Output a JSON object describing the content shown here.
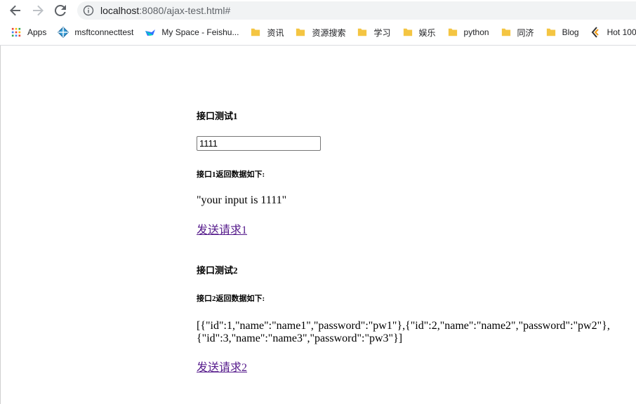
{
  "browser": {
    "url_host": "localhost",
    "url_path": ":8080/ajax-test.html#",
    "bookmarks": [
      {
        "label": "Apps",
        "icon": "apps-grid-icon"
      },
      {
        "label": "msftconnecttest",
        "icon": "globe-icon"
      },
      {
        "label": "My Space - Feishu...",
        "icon": "feishu-icon"
      },
      {
        "label": "资讯",
        "icon": "folder-icon"
      },
      {
        "label": "资源搜索",
        "icon": "folder-icon"
      },
      {
        "label": "学习",
        "icon": "folder-icon"
      },
      {
        "label": "娱乐",
        "icon": "folder-icon"
      },
      {
        "label": "python",
        "icon": "folder-icon"
      },
      {
        "label": "同济",
        "icon": "folder-icon"
      },
      {
        "label": "Blog",
        "icon": "folder-icon"
      },
      {
        "label": "Hot 100",
        "icon": "hot-icon"
      }
    ]
  },
  "page": {
    "test1": {
      "heading": "接口测试1",
      "input_value": "1111",
      "response_heading": "接口1返回数据如下:",
      "response": "\"your input is 1111\"",
      "link": "发送请求1"
    },
    "test2": {
      "heading": "接口测试2",
      "response_heading": "接口2返回数据如下:",
      "response": "[{\"id\":1,\"name\":\"name1\",\"password\":\"pw1\"},{\"id\":2,\"name\":\"name2\",\"password\":\"pw2\"},{\"id\":3,\"name\":\"name3\",\"password\":\"pw3\"}]",
      "link": "发送请求2"
    }
  },
  "colors": {
    "link_visited": "#551a8b",
    "omnibox_bg": "#f1f3f4",
    "folder": "#f4c542"
  }
}
